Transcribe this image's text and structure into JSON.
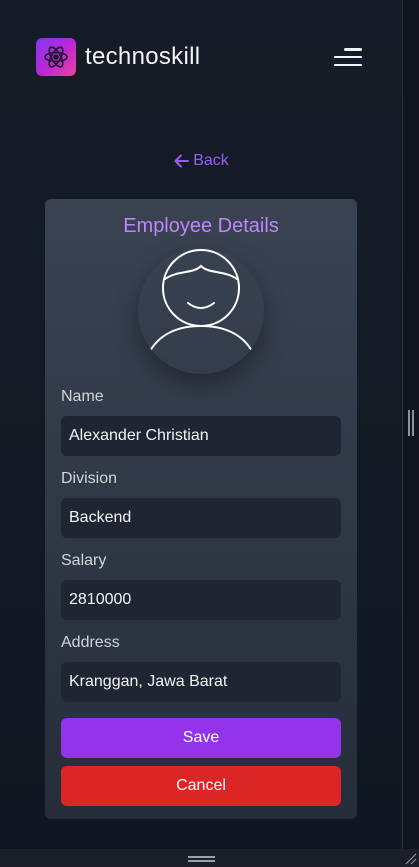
{
  "header": {
    "brand_name": "technoskill"
  },
  "nav": {
    "back_label": "Back"
  },
  "card": {
    "title": "Employee Details",
    "fields": [
      {
        "label": "Name",
        "value": "Alexander Christian"
      },
      {
        "label": "Division",
        "value": "Backend"
      },
      {
        "label": "Salary",
        "value": "2810000"
      },
      {
        "label": "Address",
        "value": "Kranggan, Jawa Barat"
      }
    ],
    "save_label": "Save",
    "cancel_label": "Cancel"
  },
  "colors": {
    "accent": "#9333ea",
    "title": "#c084fc",
    "danger": "#dc2626",
    "back_link": "#9b5cf6"
  },
  "icons": {
    "logo": "atom-icon",
    "menu": "hamburger-menu-icon",
    "back": "arrow-left-icon",
    "avatar": "user-avatar-icon"
  }
}
